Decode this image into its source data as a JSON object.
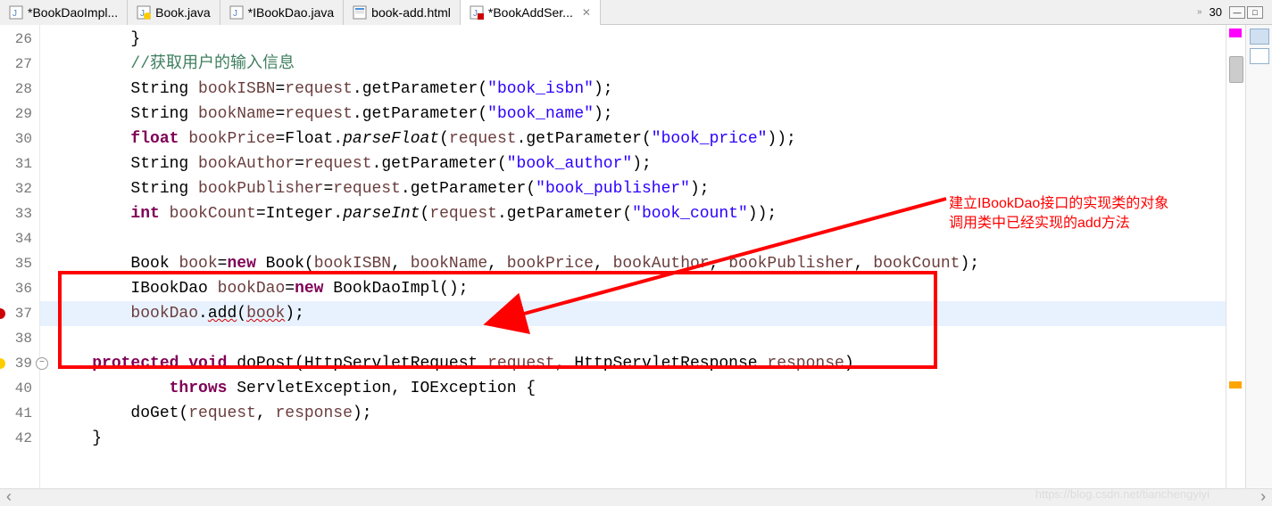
{
  "tabs": [
    {
      "label": "*BookDaoImpl...",
      "icon": "java-file-icon",
      "active": false
    },
    {
      "label": "Book.java",
      "icon": "java-warn-icon",
      "active": false
    },
    {
      "label": "*IBookDao.java",
      "icon": "java-file-icon",
      "active": false
    },
    {
      "label": "book-add.html",
      "icon": "html-file-icon",
      "active": false
    },
    {
      "label": "*BookAddSer...",
      "icon": "java-error-icon",
      "active": true
    }
  ],
  "tabs_overflow": "»",
  "tabs_count": "30",
  "lines": {
    "start": 26,
    "end": 42,
    "error_lines": [
      37
    ],
    "warn_lines": [
      39
    ],
    "fold_lines": [
      39
    ],
    "highlight_line": 37
  },
  "code": {
    "l26": "        }",
    "l27_comment": "        //获取用户的输入信息",
    "l28": {
      "indent": "        ",
      "t1": "String ",
      "var": "bookISBN",
      "t2": "=",
      "req": "request",
      "t3": ".getParameter(",
      "str": "\"book_isbn\"",
      "t4": ");"
    },
    "l29": {
      "indent": "        ",
      "t1": "String ",
      "var": "bookName",
      "t2": "=",
      "req": "request",
      "t3": ".getParameter(",
      "str": "\"book_name\"",
      "t4": ");"
    },
    "l30": {
      "indent": "        ",
      "kw": "float",
      "sp": " ",
      "var": "bookPrice",
      "t2": "=Float.",
      "method": "parseFloat",
      "t3": "(",
      "req": "request",
      "t4": ".getParameter(",
      "str": "\"book_price\"",
      "t5": "));"
    },
    "l31": {
      "indent": "        ",
      "t1": "String ",
      "var": "bookAuthor",
      "t2": "=",
      "req": "request",
      "t3": ".getParameter(",
      "str": "\"book_author\"",
      "t4": ");"
    },
    "l32": {
      "indent": "        ",
      "t1": "String ",
      "var": "bookPublisher",
      "t2": "=",
      "req": "request",
      "t3": ".getParameter(",
      "str": "\"book_publisher\"",
      "t4": ");"
    },
    "l33": {
      "indent": "        ",
      "kw": "int",
      "sp": " ",
      "var": "bookCount",
      "t2": "=Integer.",
      "method": "parseInt",
      "t3": "(",
      "req": "request",
      "t4": ".getParameter(",
      "str": "\"book_count\"",
      "t5": "));"
    },
    "l34": "",
    "l35": {
      "indent": "        ",
      "t1": "Book ",
      "var": "book",
      "t2": "=",
      "kw": "new",
      "t3": " Book(",
      "args": "bookISBN",
      "c1": ", ",
      "a2": "bookName",
      "c2": ", ",
      "a3": "bookPrice",
      "c3": ", ",
      "a4": "bookAuthor",
      "c4": ", ",
      "a5": "bookPublisher",
      "c5": ", ",
      "a6": "bookCount",
      "t4": ");"
    },
    "l36": {
      "indent": "        ",
      "t1": "IBookDao ",
      "var": "bookDao",
      "t2": "=",
      "kw": "new",
      "t3": " BookDaoImpl();"
    },
    "l37": {
      "indent": "        ",
      "var": "bookDao",
      "t2": ".",
      "method": "add",
      "t3": "(",
      "arg": "book",
      "t4": ");"
    },
    "l38": "",
    "l39": {
      "indent": "    ",
      "kw1": "protected",
      "sp1": " ",
      "kw2": "void",
      "t1": " doPost(HttpServletRequest ",
      "p1": "request",
      "t2": ", HttpServletResponse ",
      "p2": "response",
      "t3": ")"
    },
    "l40": {
      "indent": "            ",
      "kw": "throws",
      "t1": " ServletException, IOException {"
    },
    "l41": {
      "indent": "        ",
      "t1": "doGet(",
      "p1": "request",
      "t2": ", ",
      "p2": "response",
      "t3": ");"
    },
    "l42": "    }"
  },
  "annotation": {
    "line1": "建立IBookDao接口的实现类的对象",
    "line2": "调用类中已经实现的add方法"
  },
  "watermark": "https://blog.csdn.net/tianchengyiyi"
}
